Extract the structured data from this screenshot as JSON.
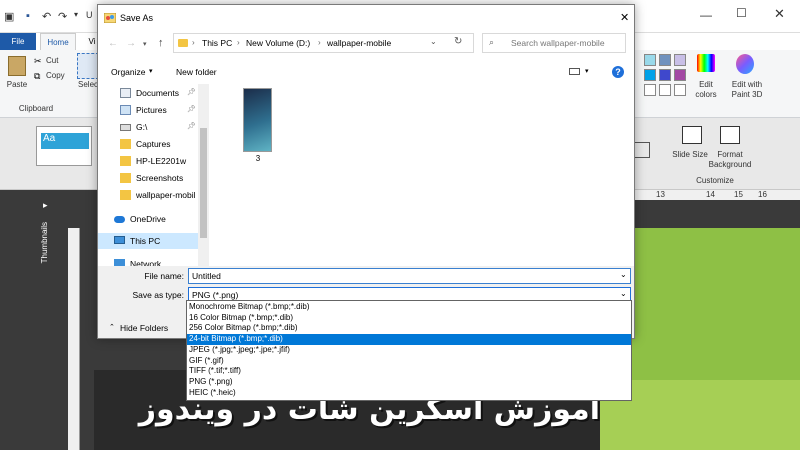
{
  "paint": {
    "title_partial": "U",
    "tabs": [
      {
        "label": "File"
      },
      {
        "label": "Home"
      },
      {
        "label": "Vi"
      }
    ],
    "ribbon": {
      "paste": "Paste",
      "cut": "Cut",
      "copy": "Copy",
      "clipboard": "Clipboard",
      "select": "Selec",
      "edit_colors": "Edit colors",
      "edit_paint3d": "Edit with Paint 3D"
    }
  },
  "ppt": {
    "slide_size": "Slide Size",
    "format_background": "Format Background",
    "customize": "Customize",
    "thumbnails": "Thumbnails",
    "ruler_numbers": [
      "13",
      "14",
      "15",
      "16"
    ],
    "slide_text": "آموزش اسکرین شات در ویندوز"
  },
  "dialog": {
    "title": "Save As",
    "breadcrumb": [
      "This PC",
      "New Volume (D:)",
      "wallpaper-mobile"
    ],
    "search_placeholder": "Search wallpaper-mobile",
    "organize": "Organize",
    "new_folder": "New folder",
    "nav_items": [
      {
        "label": "Documents",
        "icon": "documents-icon"
      },
      {
        "label": "Pictures",
        "icon": "pictures-icon"
      },
      {
        "label": "G:\\",
        "icon": "drive-icon"
      },
      {
        "label": "Captures",
        "icon": "folder-icon"
      },
      {
        "label": "HP-LE2201w",
        "icon": "folder-icon"
      },
      {
        "label": "Screenshots",
        "icon": "folder-icon"
      },
      {
        "label": "wallpaper-mobil",
        "icon": "folder-icon"
      },
      {
        "label": "OneDrive",
        "icon": "onedrive-icon"
      },
      {
        "label": "This PC",
        "icon": "computer-icon"
      },
      {
        "label": "Network",
        "icon": "network-icon"
      }
    ],
    "file_item": {
      "name": "3"
    },
    "file_name_label": "File name:",
    "file_name_value": "Untitled",
    "save_type_label": "Save as type:",
    "save_type_value": "PNG (*.png)",
    "hide_folders": "Hide Folders",
    "type_options": [
      "Monochrome Bitmap (*.bmp;*.dib)",
      "16 Color Bitmap (*.bmp;*.dib)",
      "256 Color Bitmap (*.bmp;*.dib)",
      "24-bit Bitmap (*.bmp;*.dib)",
      "JPEG (*.jpg;*.jpeg;*.jpe;*.jfif)",
      "GIF (*.gif)",
      "TIFF (*.tif;*.tiff)",
      "PNG (*.png)",
      "HEIC (*.heic)"
    ],
    "selected_option_index": 3
  },
  "colors": {
    "accent": "#0078d7",
    "slide_green": "#8ec045"
  }
}
